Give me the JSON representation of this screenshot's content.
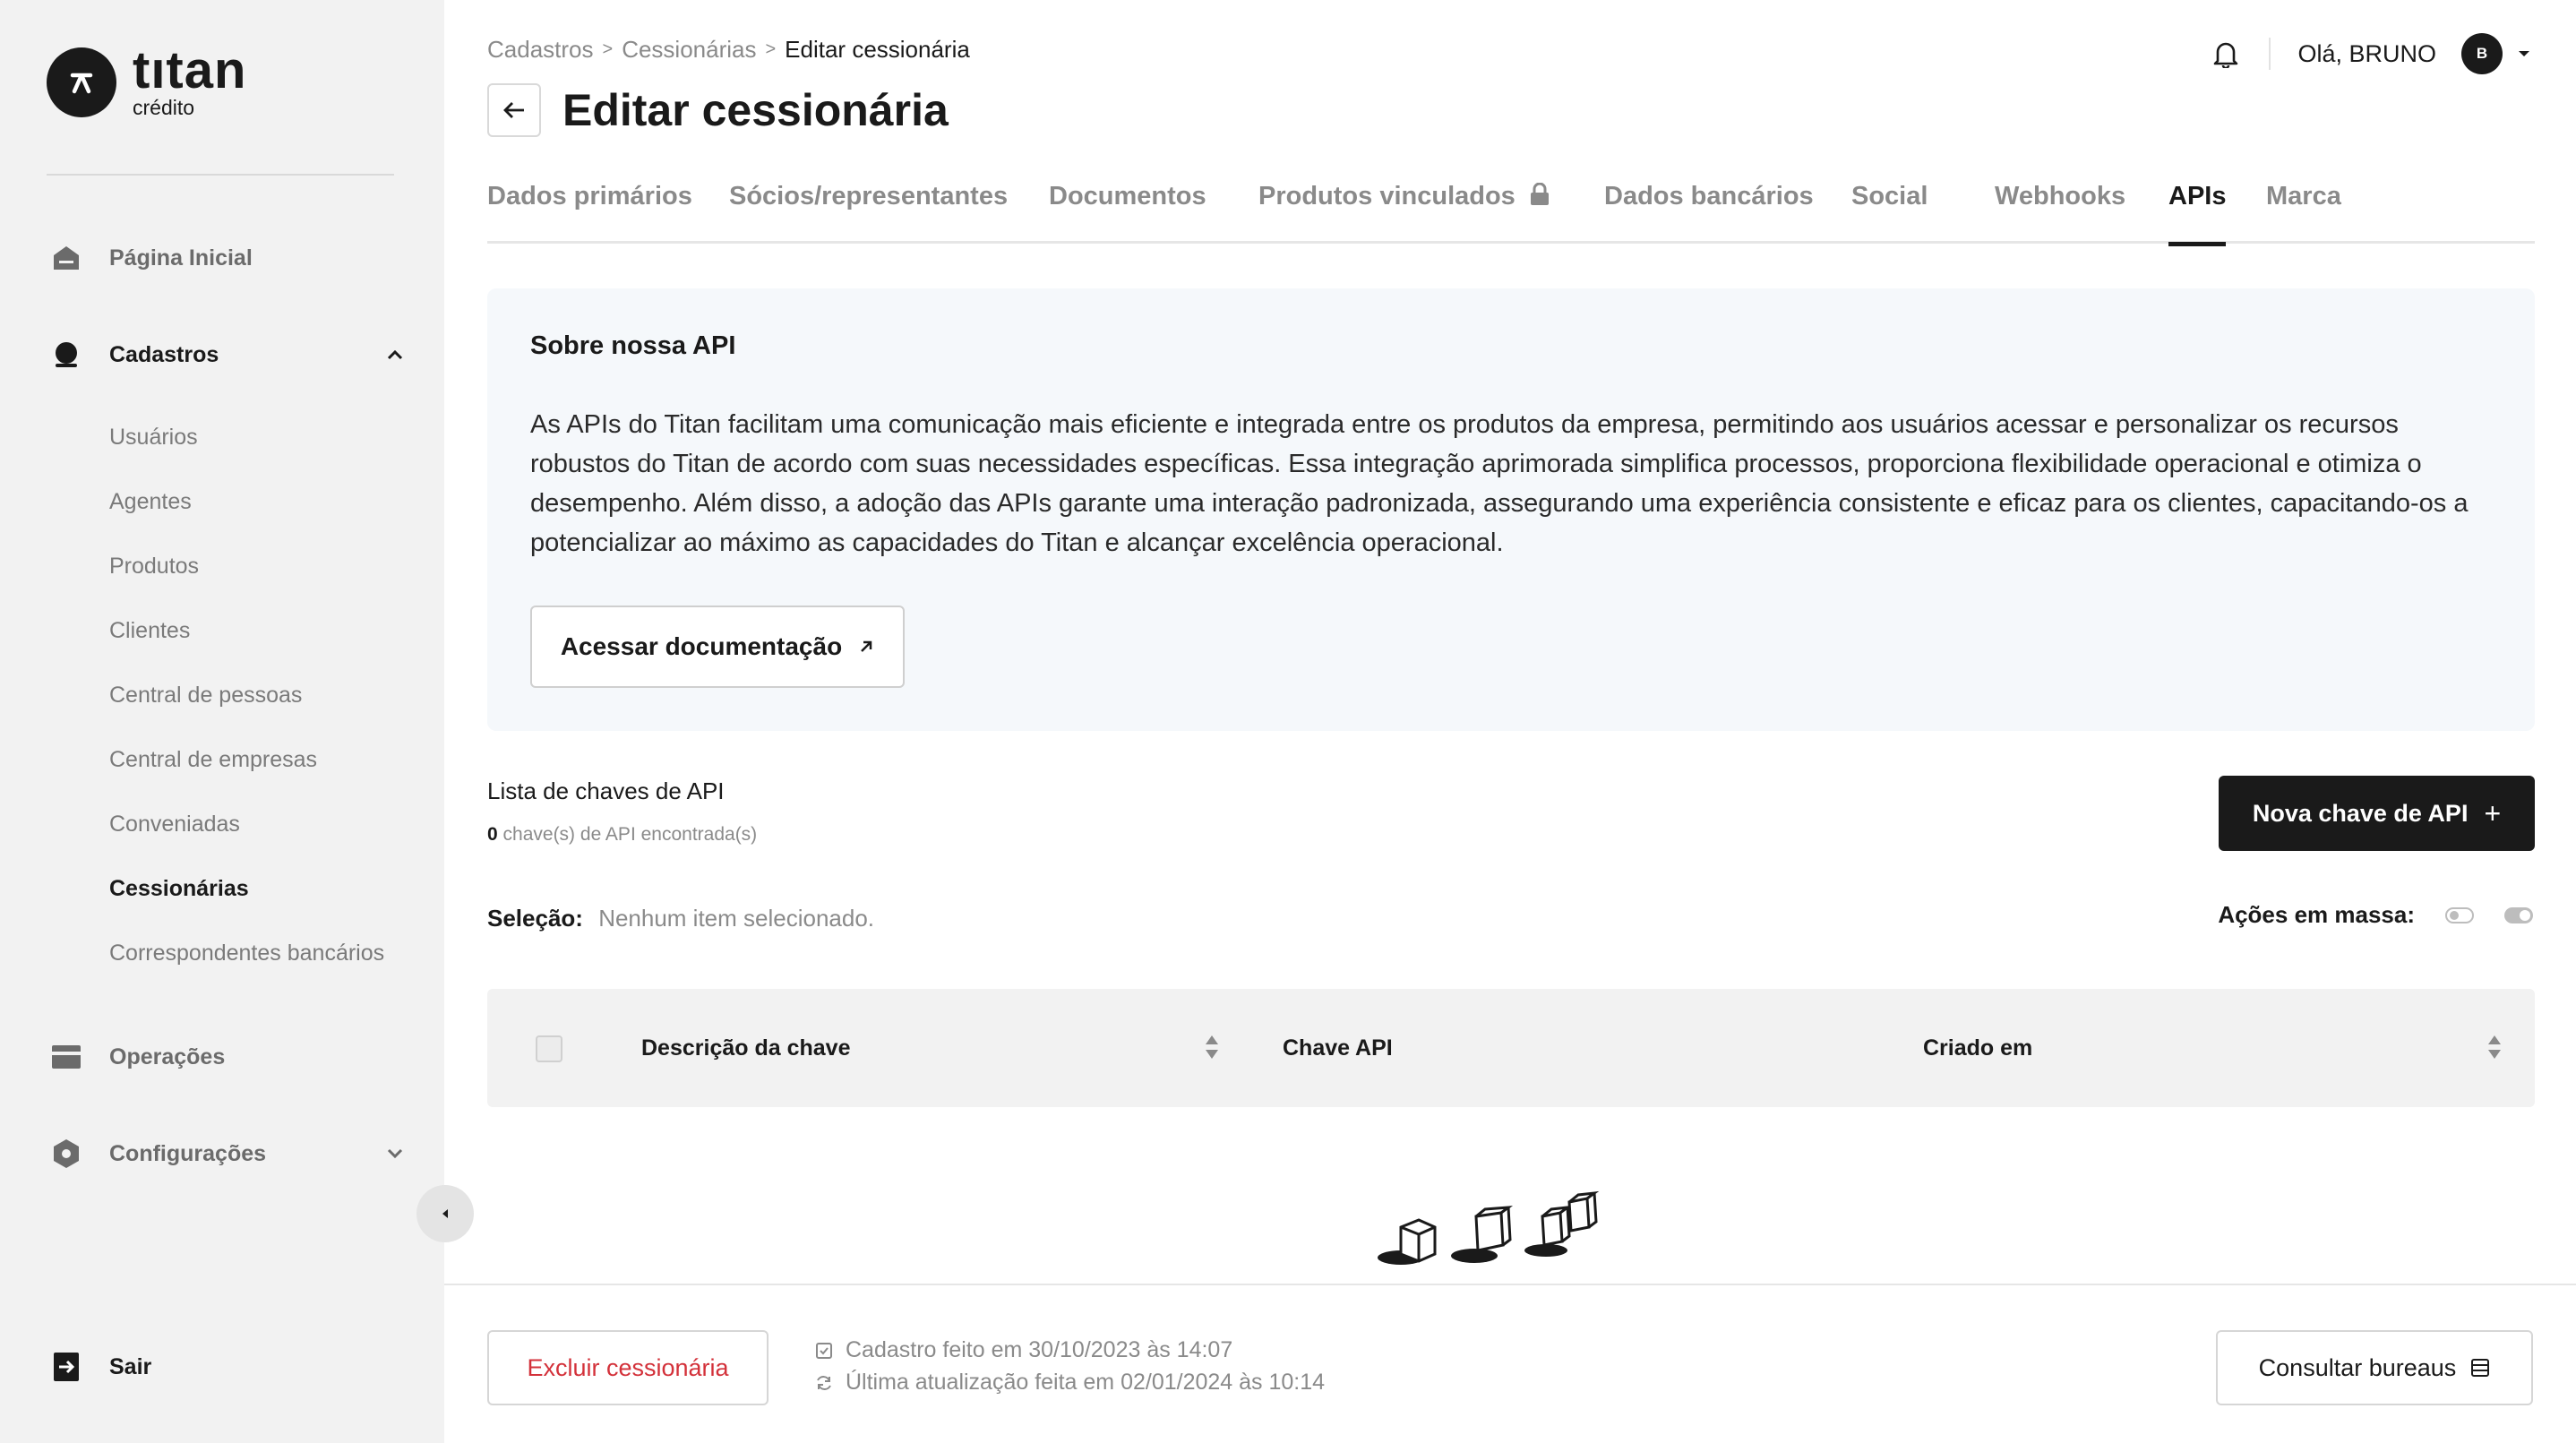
{
  "brand": {
    "name": "tıtan",
    "sub": "crédito"
  },
  "sidebar": {
    "items": [
      {
        "label": "Página Inicial",
        "icon": "home-icon"
      },
      {
        "label": "Cadastros",
        "icon": "user-icon"
      },
      {
        "label": "Operações",
        "icon": "card-icon"
      },
      {
        "label": "Configurações",
        "icon": "gear-hex-icon"
      }
    ],
    "sub_items": [
      "Usuários",
      "Agentes",
      "Produtos",
      "Clientes",
      "Central de pessoas",
      "Central de empresas",
      "Conveniadas",
      "Cessionárias",
      "Correspondentes bancários"
    ],
    "active_sub": "Cessionárias",
    "logout": "Sair"
  },
  "breadcrumb": {
    "items": [
      "Cadastros",
      "Cessionárias"
    ],
    "separator": ">",
    "current": "Editar cessionária"
  },
  "page_title": "Editar cessionária",
  "header": {
    "greeting": "Olá, BRUNO",
    "avatar_initial": "B"
  },
  "tabs": [
    {
      "label": "Dados primários"
    },
    {
      "label": "Sócios/representantes"
    },
    {
      "label": "Documentos"
    },
    {
      "label": "Produtos vinculados"
    },
    {
      "label": "Dados bancários"
    },
    {
      "label": "Social"
    },
    {
      "label": "Webhooks"
    },
    {
      "label": "APIs"
    },
    {
      "label": "Marca"
    }
  ],
  "active_tab": "APIs",
  "about": {
    "title": "Sobre nossa API",
    "text": "As APIs do Titan facilitam uma comunicação mais eficiente e integrada entre os produtos da empresa, permitindo aos usuários acessar e personalizar os recursos robustos do Titan de acordo com suas necessidades específicas. Essa integração aprimorada simplifica processos, proporciona flexibilidade operacional e otimiza o desempenho. Além disso, a adoção das APIs garante uma interação padronizada, assegurando uma experiência consistente e eficaz para os clientes, capacitando-os a potencializar ao máximo as capacidades do Titan e alcançar excelência operacional.",
    "doc_button": "Acessar documentação"
  },
  "keys": {
    "title": "Lista de chaves de API",
    "count": "0",
    "count_suffix": "chave(s) de API encontrada(s)",
    "new_button": "Nova chave de API",
    "new_button_plus": "+"
  },
  "selection": {
    "label": "Seleção:",
    "value": "Nenhum item selecionado."
  },
  "bulk": {
    "label": "Ações em massa:"
  },
  "table": {
    "columns": [
      "Descrição da chave",
      "Chave API",
      "Criado em"
    ]
  },
  "footer": {
    "delete_button": "Excluir cessionária",
    "created": "Cadastro feito em 30/10/2023 às 14:07",
    "updated": "Última atualização feita em 02/01/2024 às 10:14",
    "consult_button": "Consultar bureaus"
  },
  "colors": {
    "accent": "#1a1a1a",
    "danger": "#d3313a",
    "panel": "#f5f8fb",
    "sidebar": "#f2f2f2"
  }
}
